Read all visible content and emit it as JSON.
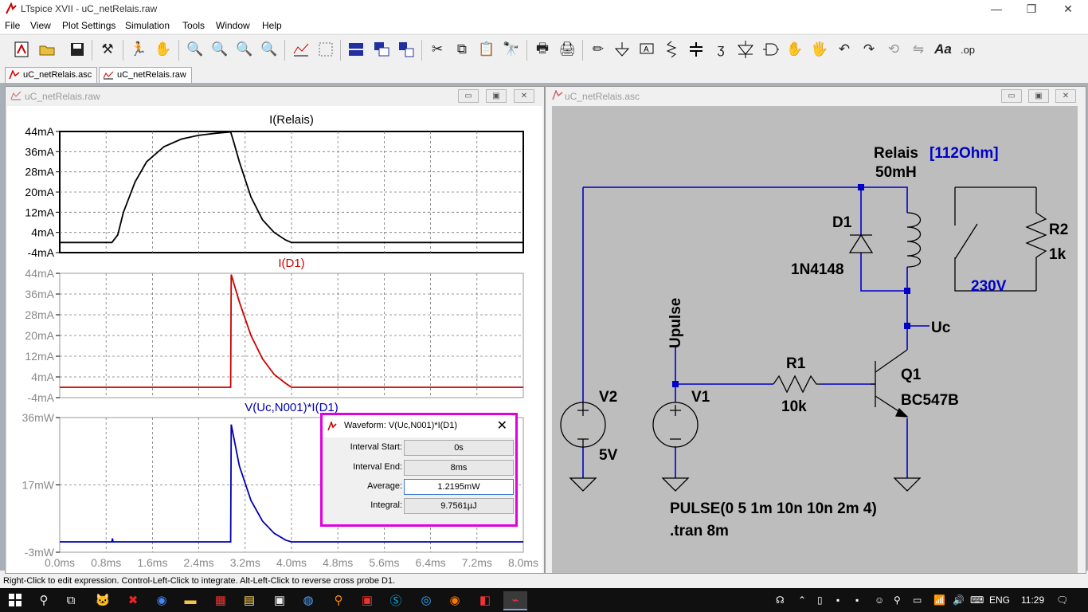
{
  "app": {
    "title": "LTspice XVII - uC_netRelais.raw"
  },
  "window_buttons": {
    "minimize": "—",
    "restore": "❐",
    "close": "✕"
  },
  "menu": [
    "File",
    "View",
    "Plot Settings",
    "Simulation",
    "Tools",
    "Window",
    "Help"
  ],
  "toolbar_icons": [
    "new-schematic-icon",
    "open-folder-icon",
    "save-icon",
    "control-panel-icon",
    "run-icon",
    "halt-icon",
    "zoom-in-icon",
    "zoom-pan-icon",
    "zoom-out-icon",
    "zoom-full-icon",
    "autorange-icon",
    "mark-unused-icon",
    "tile-horizontal-icon",
    "cascade-icon",
    "tile-vertical-icon",
    "cut-icon",
    "copy-icon",
    "paste-icon",
    "find-icon",
    "print-preview-icon",
    "print-icon",
    "draw-wire-icon",
    "ground-icon",
    "label-net-icon",
    "resistor-icon",
    "capacitor-icon",
    "inductor-icon",
    "diode-icon",
    "component-icon",
    "move-icon",
    "drag-icon",
    "undo-icon",
    "redo-icon",
    "rotate-icon",
    "mirror-icon",
    "text-icon",
    "spice-directive-icon"
  ],
  "tabs": [
    {
      "label": "uC_netRelais.asc",
      "active": false
    },
    {
      "label": "uC_netRelais.raw",
      "active": true
    }
  ],
  "plot_window": {
    "title": "uC_netRelais.raw"
  },
  "schematic_window": {
    "title": "uC_netRelais.asc"
  },
  "colors": {
    "trace_black": "#000000",
    "trace_red": "#cc0000",
    "trace_blue": "#0000b4",
    "wire_blue": "#0000c8",
    "highlight_magenta": "#e000e0",
    "schematic_bg": "#bdbdbd"
  },
  "chart_data": [
    {
      "type": "line",
      "title": "I(Relais)",
      "xlim": [
        0,
        8
      ],
      "ylim": [
        -4,
        44
      ],
      "yticks": [
        "44mA",
        "36mA",
        "28mA",
        "20mA",
        "12mA",
        "4mA",
        "-4mA"
      ],
      "xticks": [
        "0.0ms",
        "0.8ms",
        "1.6ms",
        "2.4ms",
        "3.2ms",
        "4.0ms",
        "4.8ms",
        "5.6ms",
        "6.4ms",
        "7.2ms",
        "8.0ms"
      ],
      "x": [
        0,
        0.9,
        1.0,
        1.1,
        1.3,
        1.5,
        1.8,
        2.1,
        2.4,
        2.7,
        2.95,
        3.0,
        3.1,
        3.3,
        3.5,
        3.7,
        3.9,
        4.0,
        5.0,
        8.0
      ],
      "y": [
        0,
        0,
        3,
        12,
        24,
        32,
        38,
        41,
        42.5,
        43.3,
        43.8,
        40,
        32,
        18,
        9,
        4,
        1,
        0,
        0,
        0
      ]
    },
    {
      "type": "line",
      "title": "I(D1)",
      "xlim": [
        0,
        8
      ],
      "ylim": [
        -4,
        44
      ],
      "yticks": [
        "44mA",
        "36mA",
        "28mA",
        "20mA",
        "12mA",
        "4mA",
        "-4mA"
      ],
      "x": [
        0,
        0.9,
        1.0,
        2.95,
        2.96,
        3.1,
        3.3,
        3.5,
        3.7,
        3.9,
        4.0,
        5.0,
        8.0
      ],
      "y": [
        0,
        0,
        0,
        0,
        43.5,
        33,
        20,
        11,
        5,
        1.5,
        0,
        0,
        0
      ]
    },
    {
      "type": "line",
      "title": "V(Uc,N001)*I(D1)",
      "xlim": [
        0,
        8
      ],
      "ylim": [
        -3,
        36
      ],
      "yticks": [
        "36mW",
        "17mW",
        "-3mW"
      ],
      "x": [
        0,
        0.9,
        0.91,
        0.92,
        2.95,
        2.96,
        3.1,
        3.3,
        3.5,
        3.7,
        3.9,
        4.0,
        5.0,
        8.0
      ],
      "y": [
        0,
        0,
        1,
        0,
        0,
        34,
        22,
        12,
        6,
        2.5,
        0.5,
        0,
        0,
        0
      ]
    }
  ],
  "schematic": {
    "labels": {
      "relais": "Relais",
      "relais_param": "[112Ohm]",
      "relais_ind": "50mH",
      "d1": "D1",
      "d1_model": "1N4148",
      "r2": "R2",
      "r2_val": "1k",
      "v230": "230V",
      "uc": "Uc",
      "upulse": "Upulse",
      "r1": "R1",
      "r1_val": "10k",
      "q1": "Q1",
      "q1_model": "BC547B",
      "v2": "V2",
      "v2_val": "5V",
      "v1": "V1",
      "pulse": "PULSE(0 5 1m 10n 10n 2m 4)",
      "tran": ".tran 8m"
    }
  },
  "waveform_dialog": {
    "title": "Waveform: V(Uc,N001)*I(D1)",
    "rows": [
      {
        "label": "Interval Start:",
        "value": "0s"
      },
      {
        "label": "Interval End:",
        "value": "8ms"
      },
      {
        "label": "Average:",
        "value": "1.2195mW"
      },
      {
        "label": "Integral:",
        "value": "9.7561µJ"
      }
    ]
  },
  "status": "Right-Click to edit expression. Control-Left-Click to integrate. Alt-Left-Click to reverse cross probe D1.",
  "taskbar": {
    "icons": [
      "windows-start-icon",
      "search-icon",
      "task-view-icon",
      "app-icon",
      "x-app-icon",
      "chrome-icon",
      "file-explorer-icon",
      "app2-icon",
      "notepad-icon",
      "terminal-icon",
      "media-icon",
      "search-app-icon",
      "app3-icon",
      "skype-icon",
      "browser-icon",
      "firefox-icon",
      "app4-icon",
      "ltspice-icon"
    ],
    "lang": "ENG",
    "time": "11:29"
  }
}
